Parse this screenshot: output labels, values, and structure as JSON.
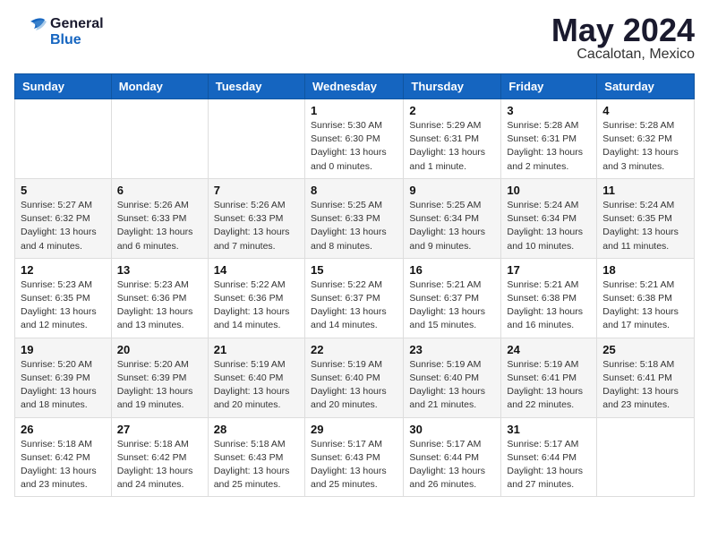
{
  "header": {
    "logo_line1": "General",
    "logo_line2": "Blue",
    "month_year": "May 2024",
    "location": "Cacalotan, Mexico"
  },
  "weekdays": [
    "Sunday",
    "Monday",
    "Tuesday",
    "Wednesday",
    "Thursday",
    "Friday",
    "Saturday"
  ],
  "weeks": [
    [
      {
        "day": "",
        "sunrise": "",
        "sunset": "",
        "daylight": ""
      },
      {
        "day": "",
        "sunrise": "",
        "sunset": "",
        "daylight": ""
      },
      {
        "day": "",
        "sunrise": "",
        "sunset": "",
        "daylight": ""
      },
      {
        "day": "1",
        "sunrise": "Sunrise: 5:30 AM",
        "sunset": "Sunset: 6:30 PM",
        "daylight": "Daylight: 13 hours and 0 minutes."
      },
      {
        "day": "2",
        "sunrise": "Sunrise: 5:29 AM",
        "sunset": "Sunset: 6:31 PM",
        "daylight": "Daylight: 13 hours and 1 minute."
      },
      {
        "day": "3",
        "sunrise": "Sunrise: 5:28 AM",
        "sunset": "Sunset: 6:31 PM",
        "daylight": "Daylight: 13 hours and 2 minutes."
      },
      {
        "day": "4",
        "sunrise": "Sunrise: 5:28 AM",
        "sunset": "Sunset: 6:32 PM",
        "daylight": "Daylight: 13 hours and 3 minutes."
      }
    ],
    [
      {
        "day": "5",
        "sunrise": "Sunrise: 5:27 AM",
        "sunset": "Sunset: 6:32 PM",
        "daylight": "Daylight: 13 hours and 4 minutes."
      },
      {
        "day": "6",
        "sunrise": "Sunrise: 5:26 AM",
        "sunset": "Sunset: 6:33 PM",
        "daylight": "Daylight: 13 hours and 6 minutes."
      },
      {
        "day": "7",
        "sunrise": "Sunrise: 5:26 AM",
        "sunset": "Sunset: 6:33 PM",
        "daylight": "Daylight: 13 hours and 7 minutes."
      },
      {
        "day": "8",
        "sunrise": "Sunrise: 5:25 AM",
        "sunset": "Sunset: 6:33 PM",
        "daylight": "Daylight: 13 hours and 8 minutes."
      },
      {
        "day": "9",
        "sunrise": "Sunrise: 5:25 AM",
        "sunset": "Sunset: 6:34 PM",
        "daylight": "Daylight: 13 hours and 9 minutes."
      },
      {
        "day": "10",
        "sunrise": "Sunrise: 5:24 AM",
        "sunset": "Sunset: 6:34 PM",
        "daylight": "Daylight: 13 hours and 10 minutes."
      },
      {
        "day": "11",
        "sunrise": "Sunrise: 5:24 AM",
        "sunset": "Sunset: 6:35 PM",
        "daylight": "Daylight: 13 hours and 11 minutes."
      }
    ],
    [
      {
        "day": "12",
        "sunrise": "Sunrise: 5:23 AM",
        "sunset": "Sunset: 6:35 PM",
        "daylight": "Daylight: 13 hours and 12 minutes."
      },
      {
        "day": "13",
        "sunrise": "Sunrise: 5:23 AM",
        "sunset": "Sunset: 6:36 PM",
        "daylight": "Daylight: 13 hours and 13 minutes."
      },
      {
        "day": "14",
        "sunrise": "Sunrise: 5:22 AM",
        "sunset": "Sunset: 6:36 PM",
        "daylight": "Daylight: 13 hours and 14 minutes."
      },
      {
        "day": "15",
        "sunrise": "Sunrise: 5:22 AM",
        "sunset": "Sunset: 6:37 PM",
        "daylight": "Daylight: 13 hours and 14 minutes."
      },
      {
        "day": "16",
        "sunrise": "Sunrise: 5:21 AM",
        "sunset": "Sunset: 6:37 PM",
        "daylight": "Daylight: 13 hours and 15 minutes."
      },
      {
        "day": "17",
        "sunrise": "Sunrise: 5:21 AM",
        "sunset": "Sunset: 6:38 PM",
        "daylight": "Daylight: 13 hours and 16 minutes."
      },
      {
        "day": "18",
        "sunrise": "Sunrise: 5:21 AM",
        "sunset": "Sunset: 6:38 PM",
        "daylight": "Daylight: 13 hours and 17 minutes."
      }
    ],
    [
      {
        "day": "19",
        "sunrise": "Sunrise: 5:20 AM",
        "sunset": "Sunset: 6:39 PM",
        "daylight": "Daylight: 13 hours and 18 minutes."
      },
      {
        "day": "20",
        "sunrise": "Sunrise: 5:20 AM",
        "sunset": "Sunset: 6:39 PM",
        "daylight": "Daylight: 13 hours and 19 minutes."
      },
      {
        "day": "21",
        "sunrise": "Sunrise: 5:19 AM",
        "sunset": "Sunset: 6:40 PM",
        "daylight": "Daylight: 13 hours and 20 minutes."
      },
      {
        "day": "22",
        "sunrise": "Sunrise: 5:19 AM",
        "sunset": "Sunset: 6:40 PM",
        "daylight": "Daylight: 13 hours and 20 minutes."
      },
      {
        "day": "23",
        "sunrise": "Sunrise: 5:19 AM",
        "sunset": "Sunset: 6:40 PM",
        "daylight": "Daylight: 13 hours and 21 minutes."
      },
      {
        "day": "24",
        "sunrise": "Sunrise: 5:19 AM",
        "sunset": "Sunset: 6:41 PM",
        "daylight": "Daylight: 13 hours and 22 minutes."
      },
      {
        "day": "25",
        "sunrise": "Sunrise: 5:18 AM",
        "sunset": "Sunset: 6:41 PM",
        "daylight": "Daylight: 13 hours and 23 minutes."
      }
    ],
    [
      {
        "day": "26",
        "sunrise": "Sunrise: 5:18 AM",
        "sunset": "Sunset: 6:42 PM",
        "daylight": "Daylight: 13 hours and 23 minutes."
      },
      {
        "day": "27",
        "sunrise": "Sunrise: 5:18 AM",
        "sunset": "Sunset: 6:42 PM",
        "daylight": "Daylight: 13 hours and 24 minutes."
      },
      {
        "day": "28",
        "sunrise": "Sunrise: 5:18 AM",
        "sunset": "Sunset: 6:43 PM",
        "daylight": "Daylight: 13 hours and 25 minutes."
      },
      {
        "day": "29",
        "sunrise": "Sunrise: 5:17 AM",
        "sunset": "Sunset: 6:43 PM",
        "daylight": "Daylight: 13 hours and 25 minutes."
      },
      {
        "day": "30",
        "sunrise": "Sunrise: 5:17 AM",
        "sunset": "Sunset: 6:44 PM",
        "daylight": "Daylight: 13 hours and 26 minutes."
      },
      {
        "day": "31",
        "sunrise": "Sunrise: 5:17 AM",
        "sunset": "Sunset: 6:44 PM",
        "daylight": "Daylight: 13 hours and 27 minutes."
      },
      {
        "day": "",
        "sunrise": "",
        "sunset": "",
        "daylight": ""
      }
    ]
  ]
}
